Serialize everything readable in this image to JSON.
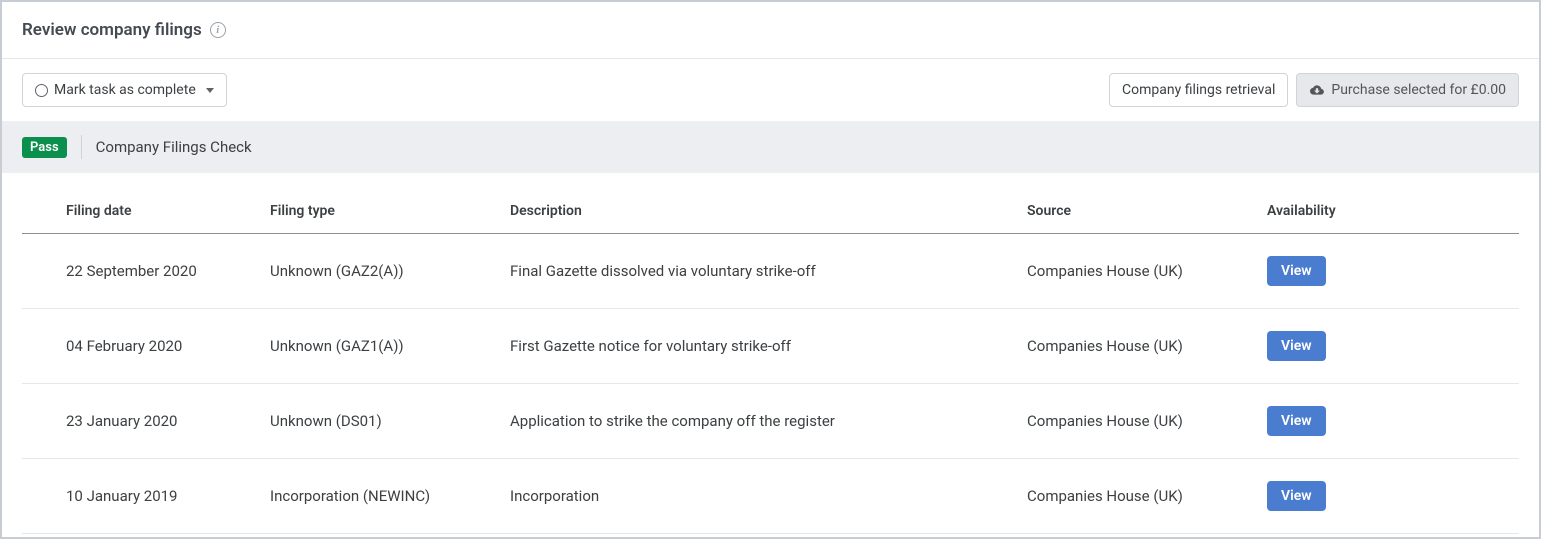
{
  "header": {
    "title": "Review company filings"
  },
  "toolbar": {
    "mark_complete": "Mark task as complete",
    "filings_retrieval": "Company filings retrieval",
    "purchase_selected": "Purchase selected for £0.00"
  },
  "status": {
    "badge": "Pass",
    "text": "Company Filings Check"
  },
  "table": {
    "headers": {
      "filing_date": "Filing date",
      "filing_type": "Filing type",
      "description": "Description",
      "source": "Source",
      "availability": "Availability"
    },
    "view_label": "View",
    "rows": [
      {
        "filing_date": "22 September 2020",
        "filing_type": "Unknown (GAZ2(A))",
        "description": "Final Gazette dissolved via voluntary strike-off",
        "source": "Companies House (UK)"
      },
      {
        "filing_date": "04 February 2020",
        "filing_type": "Unknown (GAZ1(A))",
        "description": "First Gazette notice for voluntary strike-off",
        "source": "Companies House (UK)"
      },
      {
        "filing_date": "23 January 2020",
        "filing_type": "Unknown (DS01)",
        "description": "Application to strike the company off the register",
        "source": "Companies House (UK)"
      },
      {
        "filing_date": "10 January 2019",
        "filing_type": "Incorporation (NEWINC)",
        "description": "Incorporation",
        "source": "Companies House (UK)"
      }
    ]
  }
}
